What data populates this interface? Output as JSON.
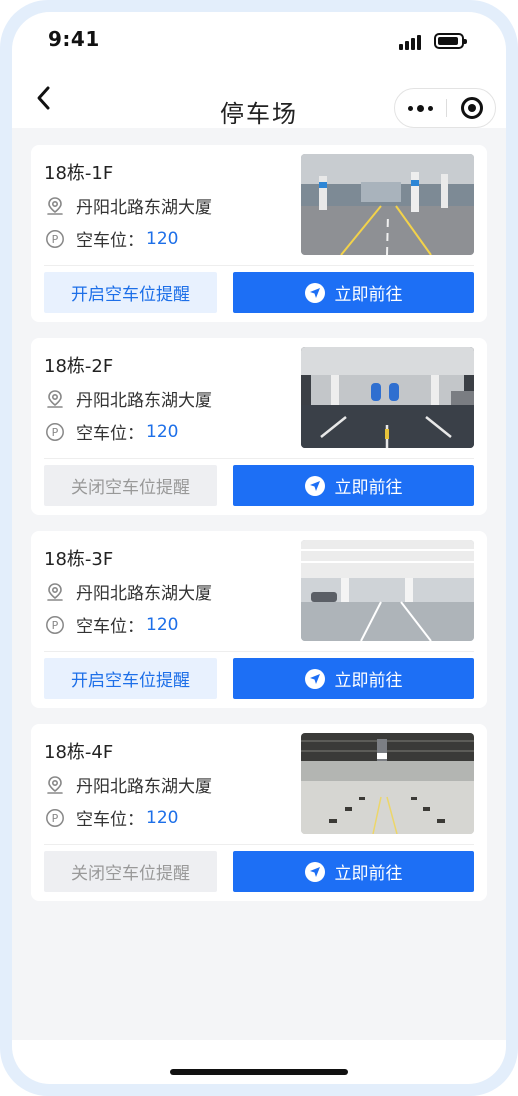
{
  "status_bar": {
    "time": "9:41"
  },
  "nav": {
    "title": "停车场"
  },
  "parking_lots": [
    {
      "name": "18栋-1F",
      "address": "丹阳北路东湖大厦",
      "spots_label": "空车位：",
      "spots": "120",
      "remind_label": "开启空车位提醒",
      "remind_state": "on",
      "go_label": "立即前往"
    },
    {
      "name": "18栋-2F",
      "address": "丹阳北路东湖大厦",
      "spots_label": "空车位：",
      "spots": "120",
      "remind_label": "关闭空车位提醒",
      "remind_state": "off",
      "go_label": "立即前往"
    },
    {
      "name": "18栋-3F",
      "address": "丹阳北路东湖大厦",
      "spots_label": "空车位：",
      "spots": "120",
      "remind_label": "开启空车位提醒",
      "remind_state": "on",
      "go_label": "立即前往"
    },
    {
      "name": "18栋-4F",
      "address": "丹阳北路东湖大厦",
      "spots_label": "空车位：",
      "spots": "120",
      "remind_label": "关闭空车位提醒",
      "remind_state": "off",
      "go_label": "立即前往"
    }
  ],
  "icons": {
    "back": "chevron-left-icon",
    "more": "more-dots-icon",
    "close": "target-circle-icon",
    "address": "location-pin-icon",
    "spots": "parking-p-icon",
    "navigate": "navigation-arrow-icon"
  },
  "colors": {
    "accent": "#1d6ff5",
    "accent_text": "#1d6fe8",
    "remind_on_bg": "#e8f1fe",
    "remind_off_bg": "#eeeff2",
    "page_bg": "#f4f5f7"
  }
}
